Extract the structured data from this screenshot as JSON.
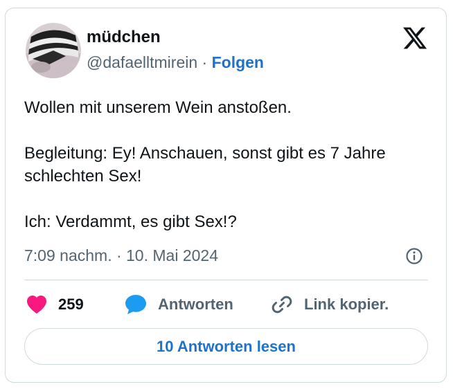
{
  "tweet": {
    "author_name": "müdchen",
    "handle": "@dafaelltmirein",
    "separator": "·",
    "follow_label": "Folgen",
    "lines": [
      "Wollen mit unserem Wein anstoßen.",
      "Begleitung: Ey! Anschauen, sonst gibt es 7 Jahre schlechten Sex!",
      "Ich: Verdammt, es gibt Sex!?"
    ],
    "timestamp": "7:09 nachm. · 10. Mai 2024"
  },
  "actions": {
    "like_count": "259",
    "reply_label": "Antworten",
    "copy_label": "Link kopier."
  },
  "read_replies_label": "10 Antworten lesen",
  "icons": {
    "platform": "x-logo-icon",
    "info": "info-icon",
    "like": "heart-icon",
    "reply": "speech-bubble-icon",
    "copy": "link-icon"
  },
  "colors": {
    "heart": "#f91880",
    "reply_bubble": "#1d9bf0",
    "link_blue": "#1d73c9",
    "muted_text": "#536471",
    "border": "#cfd9de"
  }
}
